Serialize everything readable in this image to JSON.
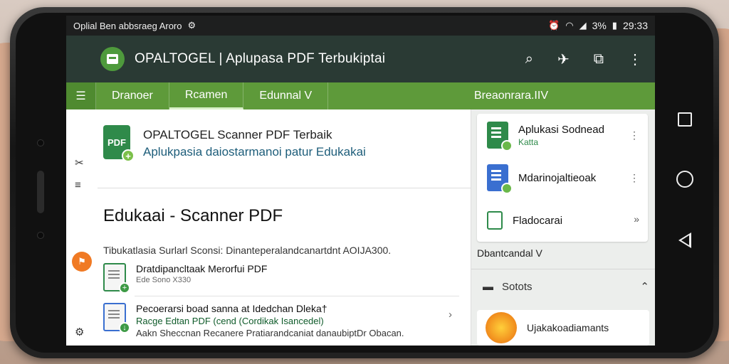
{
  "status_bar": {
    "left_text": "Oplial Ben abbsraeg Aroro",
    "time": "29:33",
    "battery": "3%"
  },
  "app_bar": {
    "title": "OPALTOGEL | Aplupasa PDF Terbukiptai",
    "actions": [
      "search-icon",
      "share-icon",
      "bookmark-icon",
      "more-icon"
    ]
  },
  "tabs": {
    "items": [
      "Dranoer",
      "Rcamen",
      "Edunnal V"
    ],
    "right": "Breaonrara.IIV"
  },
  "hero": {
    "icon_label": "PDF",
    "title": "OPALTOGEL Scanner PDF Terbaik",
    "subtitle": "Aplukpasia daiostarmanoi patur Edukakai"
  },
  "section": {
    "title": "Edukaai - Scanner PDF",
    "description": "Tibukatlasia Surlarl Sconsi: Dinanteperalandcanartdnt AOIJA300."
  },
  "list": [
    {
      "title": "Dratdipancltaak Merorfui PDF",
      "sub": "Ede Sono X330"
    },
    {
      "title": "Pecoerarsi boad sanna at Idedchan Dleka†",
      "sub2": "Racge Edtan PDF (cend (Cordikak Isancedel)",
      "sub3": "Aakn Sheccnan Recanere Pratiarandcaniat danaubiptDr Obacan."
    }
  ],
  "side": {
    "cards": [
      {
        "title": "Aplukasi Sodnead",
        "sub": "Katta"
      },
      {
        "title": "Mdarinojaltieoak",
        "sub": ""
      },
      {
        "title": "Fladocarai",
        "sub": ""
      }
    ],
    "label": "Dbantcandal V",
    "settings": "Sotots",
    "promo": "Ujakakoadiamants"
  },
  "colors": {
    "appbar": "#2a3a34",
    "tabbar": "#5e9a3a",
    "accent": "#2e8a4a"
  }
}
